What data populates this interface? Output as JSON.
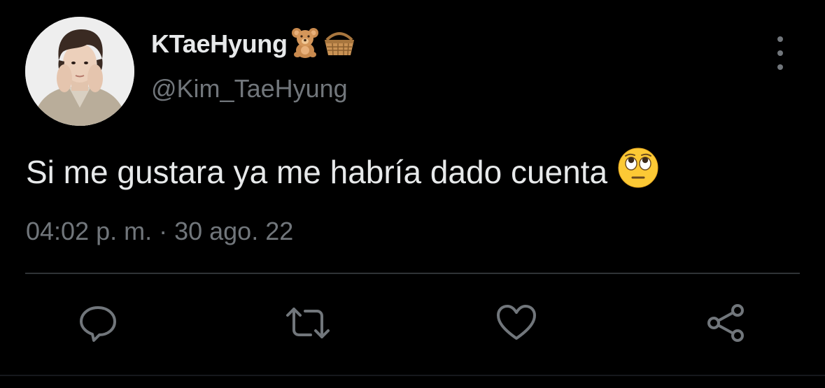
{
  "tweet": {
    "display_name": "KTaeHyung",
    "name_emojis": [
      "teddy-bear",
      "basket"
    ],
    "handle": "@Kim_TaeHyung",
    "text": "Si me gustara ya me habría dado cuenta",
    "text_emoji": "face-with-rolling-eyes",
    "timestamp": "04:02 p. m. · 30 ago. 22"
  },
  "actions": [
    {
      "name": "reply",
      "icon": "speech-bubble-icon"
    },
    {
      "name": "retweet",
      "icon": "retweet-icon"
    },
    {
      "name": "like",
      "icon": "heart-icon"
    },
    {
      "name": "share",
      "icon": "share-icon"
    }
  ],
  "colors": {
    "background": "#000000",
    "primary_text": "#e7e9ea",
    "secondary_text": "#71767b",
    "divider": "#2f3336"
  }
}
